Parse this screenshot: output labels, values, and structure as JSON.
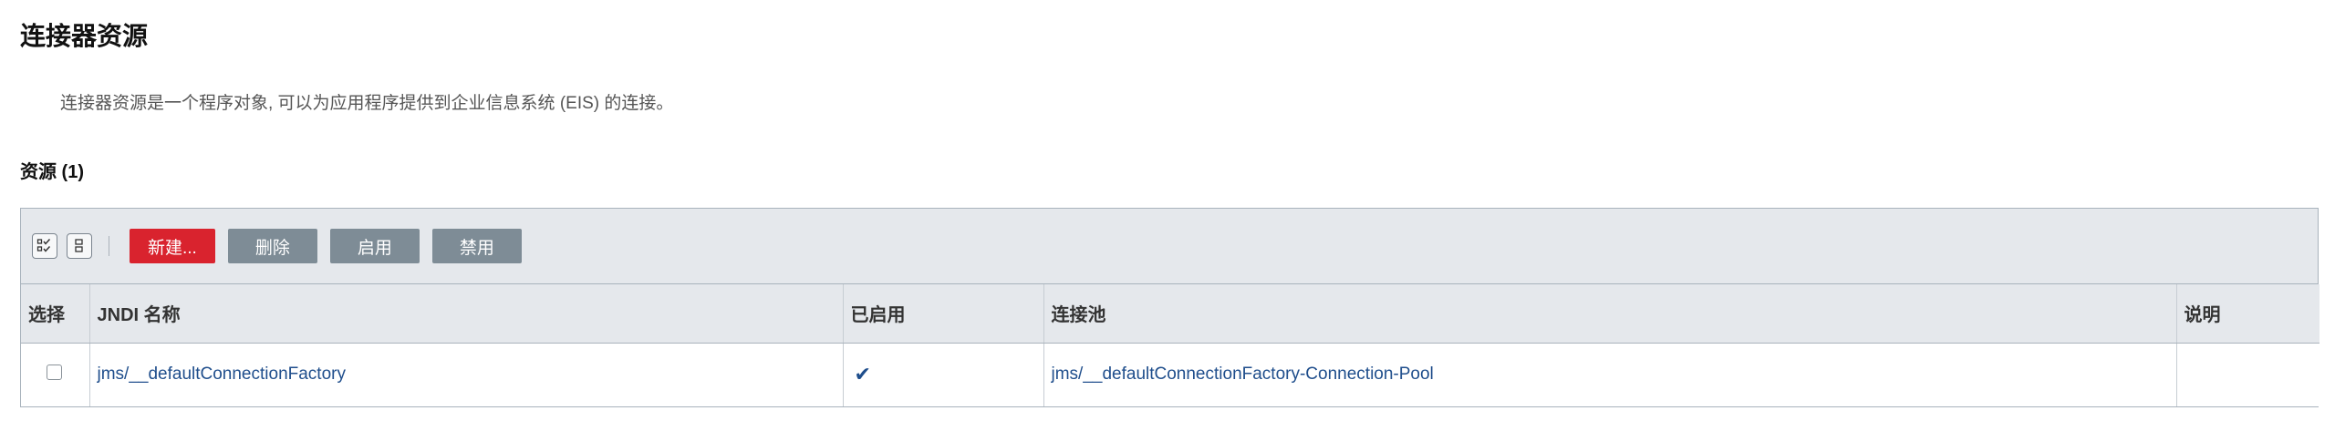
{
  "page": {
    "title": "连接器资源",
    "description": "连接器资源是一个程序对象, 可以为应用程序提供到企业信息系统 (EIS) 的连接。"
  },
  "section": {
    "title": "资源 (1)"
  },
  "toolbar": {
    "select_all_icon": "select-all-icon",
    "deselect_all_icon": "deselect-all-icon",
    "new_label": "新建...",
    "delete_label": "删除",
    "enable_label": "启用",
    "disable_label": "禁用"
  },
  "table": {
    "headers": {
      "select": "选择",
      "jndi_name": "JNDI 名称",
      "enabled": "已启用",
      "pool": "连接池",
      "description": "说明"
    },
    "rows": [
      {
        "selected": false,
        "jndi_name": "jms/__defaultConnectionFactory",
        "enabled": true,
        "enabled_glyph": "✔",
        "pool": "jms/__defaultConnectionFactory-Connection-Pool",
        "description": ""
      }
    ]
  },
  "colors": {
    "primary_button": "#d9232e",
    "secondary_button": "#7e8c96",
    "link": "#1f4e8c",
    "table_header_bg": "#e5e8ec"
  }
}
